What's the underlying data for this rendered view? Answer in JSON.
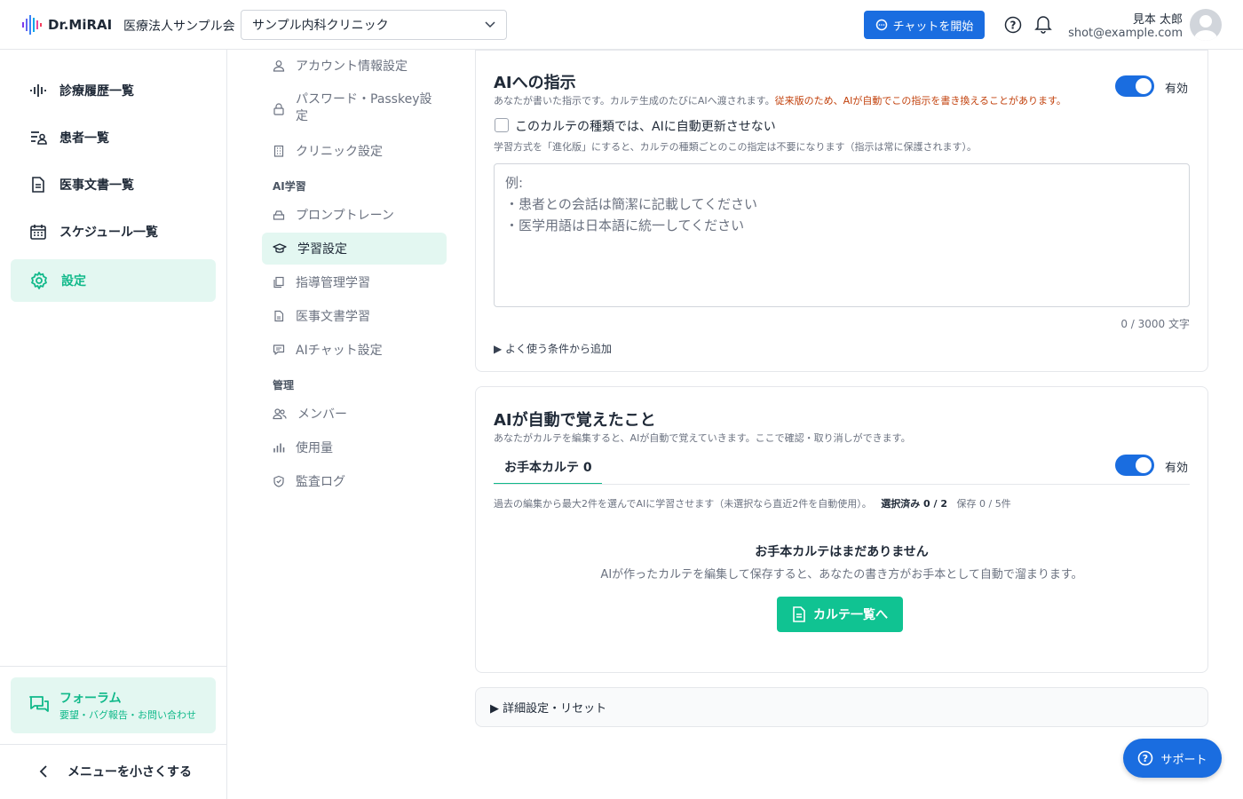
{
  "header": {
    "logo_text": "Dr.MiRAI",
    "org_name": "医療法人サンプル会",
    "clinic_select": "サンプル内科クリニック",
    "chat_button": "チャットを開始",
    "user_name": "見本 太郎",
    "user_email": "shot@example.com"
  },
  "leftnav": {
    "items": [
      {
        "label": "診療履歴一覧",
        "icon": "waveform-icon"
      },
      {
        "label": "患者一覧",
        "icon": "patient-list-icon"
      },
      {
        "label": "医事文書一覧",
        "icon": "document-icon"
      },
      {
        "label": "スケジュール一覧",
        "icon": "calendar-icon"
      },
      {
        "label": "設定",
        "icon": "gear-icon",
        "active": true
      }
    ],
    "forum_title": "フォーラム",
    "forum_sub": "要望・バグ報告・お問い合わせ",
    "collapse_label": "メニューを小さくする"
  },
  "settings_menu": {
    "items": [
      {
        "label": "アカウント情報設定",
        "icon": "user-icon"
      },
      {
        "label": "パスワード・Passkey設定",
        "icon": "lock-icon"
      },
      {
        "label": "クリニック設定",
        "icon": "building-icon"
      }
    ],
    "ai_section": "AI学習",
    "ai_items": [
      {
        "label": "プロンプトレーン",
        "icon": "tray-icon"
      },
      {
        "label": "学習設定",
        "icon": "graduation-cap-icon",
        "active": true
      },
      {
        "label": "指導管理学習",
        "icon": "copy-icon"
      },
      {
        "label": "医事文書学習",
        "icon": "file-icon"
      },
      {
        "label": "AIチャット設定",
        "icon": "chat-icon"
      }
    ],
    "admin_section": "管理",
    "admin_items": [
      {
        "label": "メンバー",
        "icon": "users-icon"
      },
      {
        "label": "使用量",
        "icon": "bar-chart-icon"
      },
      {
        "label": "監査ログ",
        "icon": "shield-icon"
      }
    ]
  },
  "instruction_card": {
    "title": "AIへの指示",
    "desc": "あなたが書いた指示です。カルテ生成のたびにAIへ渡されます。",
    "warning": "従来版のため、AIが自動でこの指示を書き換えることがあります。",
    "toggle_label": "有効",
    "checkbox_label": "このカルテの種類では、AIに自動更新させない",
    "hint": "学習方式を「進化版」にすると、カルテの種類ごとのこの指定は不要になります（指示は常に保護されます）。",
    "placeholder": "例:\n・患者との会話は簡潔に記載してください\n・医学用語は日本語に統一してください",
    "counter": "0 / 3000 文字",
    "add_condition": "▶ よく使う条件から追加"
  },
  "learned_card": {
    "title": "AIが自動で覚えたこと",
    "desc": "あなたがカルテを編集すると、AIが自動で覚えていきます。ここで確認・取り消しができます。",
    "toggle_label": "有効",
    "tab_label": "お手本カルテ 0",
    "meta_text": "過去の編集から最大2件を選んでAIに学習させます（未選択なら直近2件を自動使用）。",
    "selected_label": "選択済み 0 / 2",
    "saved_label": "保存 0 / 5件",
    "empty_title": "お手本カルテはまだありません",
    "empty_sub": "AIが作ったカルテを編集して保存すると、あなたの書き方がお手本として自動で溜まります。",
    "button_label": "カルテ一覧へ"
  },
  "detail_label": "▶ 詳細設定・リセット",
  "support_label": "サポート",
  "colors": {
    "accent_green": "#10b98a",
    "brand_blue": "#1a6de0",
    "warning": "#c2410c"
  }
}
